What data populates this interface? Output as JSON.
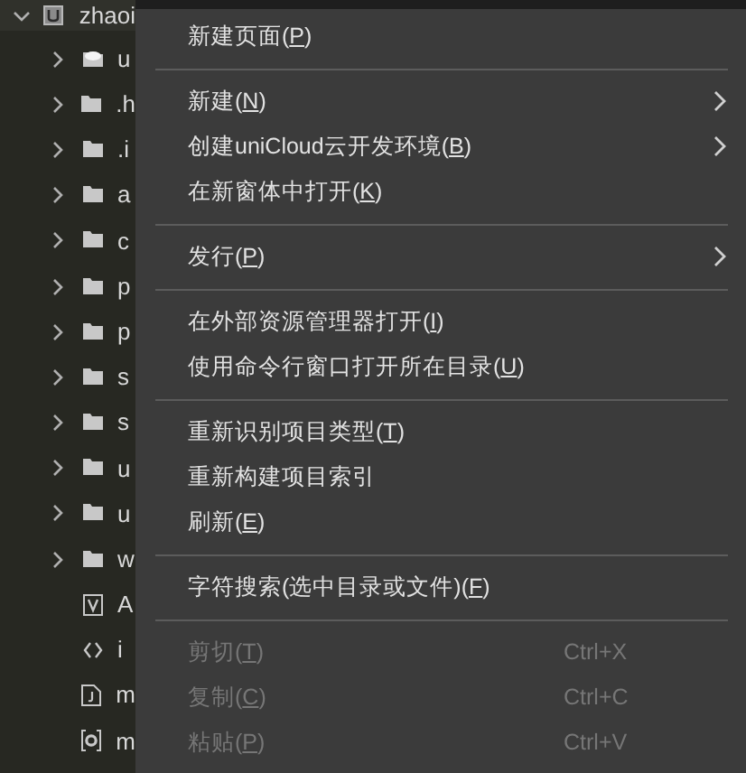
{
  "project_tree": {
    "root": {
      "label": "zhaoi",
      "expanded": true
    },
    "children": [
      {
        "kind": "cloud-folder",
        "label": "u",
        "expanded": false
      },
      {
        "kind": "folder",
        "label": ".h",
        "expanded": false
      },
      {
        "kind": "folder",
        "label": ".i",
        "expanded": false
      },
      {
        "kind": "folder",
        "label": "a",
        "expanded": false
      },
      {
        "kind": "folder",
        "label": "c",
        "expanded": false
      },
      {
        "kind": "folder",
        "label": "p",
        "expanded": false
      },
      {
        "kind": "folder",
        "label": "p",
        "expanded": false
      },
      {
        "kind": "folder",
        "label": "s",
        "expanded": false
      },
      {
        "kind": "folder",
        "label": "s",
        "expanded": false
      },
      {
        "kind": "folder",
        "label": "u",
        "expanded": false
      },
      {
        "kind": "folder",
        "label": "u",
        "expanded": false
      },
      {
        "kind": "folder",
        "label": "w",
        "expanded": false
      },
      {
        "kind": "vue-file",
        "label": "A"
      },
      {
        "kind": "code-file",
        "label": "i"
      },
      {
        "kind": "json-file",
        "label": "m"
      },
      {
        "kind": "config-file",
        "label": "m"
      }
    ]
  },
  "context_menu": [
    {
      "kind": "item",
      "label": "新建页面(",
      "access_key": "P",
      "label_end": ")",
      "disabled": false,
      "submenu": false
    },
    {
      "kind": "separator"
    },
    {
      "kind": "item",
      "label": "新建(",
      "access_key": "N",
      "label_end": ")",
      "disabled": false,
      "submenu": true
    },
    {
      "kind": "item",
      "label": "创建uniCloud云开发环境(",
      "access_key": "B",
      "label_end": ")",
      "disabled": false,
      "submenu": true
    },
    {
      "kind": "item",
      "label": "在新窗体中打开(",
      "access_key": "K",
      "label_end": ")",
      "disabled": false,
      "submenu": false
    },
    {
      "kind": "separator"
    },
    {
      "kind": "item",
      "label": "发行(",
      "access_key": "P",
      "label_end": ")",
      "disabled": false,
      "submenu": true
    },
    {
      "kind": "separator"
    },
    {
      "kind": "item",
      "label": "在外部资源管理器打开(",
      "access_key": "I",
      "label_end": ")",
      "disabled": false,
      "submenu": false
    },
    {
      "kind": "item",
      "label": "使用命令行窗口打开所在目录(",
      "access_key": "U",
      "label_end": ")",
      "disabled": false,
      "submenu": false
    },
    {
      "kind": "separator"
    },
    {
      "kind": "item",
      "label": "重新识别项目类型(",
      "access_key": "T",
      "label_end": ")",
      "disabled": false,
      "submenu": false
    },
    {
      "kind": "item",
      "label": "重新构建项目索引",
      "disabled": false,
      "submenu": false
    },
    {
      "kind": "item",
      "label": "刷新(",
      "access_key": "E",
      "label_end": ")",
      "disabled": false,
      "submenu": false
    },
    {
      "kind": "separator"
    },
    {
      "kind": "item",
      "label": "字符搜索(选中目录或文件)(",
      "access_key": "F",
      "label_end": ")",
      "disabled": false,
      "submenu": false
    },
    {
      "kind": "separator"
    },
    {
      "kind": "item",
      "label": "剪切(",
      "access_key": "T",
      "label_end": ")",
      "shortcut": "Ctrl+X",
      "disabled": true,
      "submenu": false
    },
    {
      "kind": "item",
      "label": "复制(",
      "access_key": "C",
      "label_end": ")",
      "shortcut": "Ctrl+C",
      "disabled": true,
      "submenu": false
    },
    {
      "kind": "item",
      "label": "粘贴(",
      "access_key": "P",
      "label_end": ")",
      "shortcut": "Ctrl+V",
      "disabled": true,
      "submenu": false
    }
  ]
}
